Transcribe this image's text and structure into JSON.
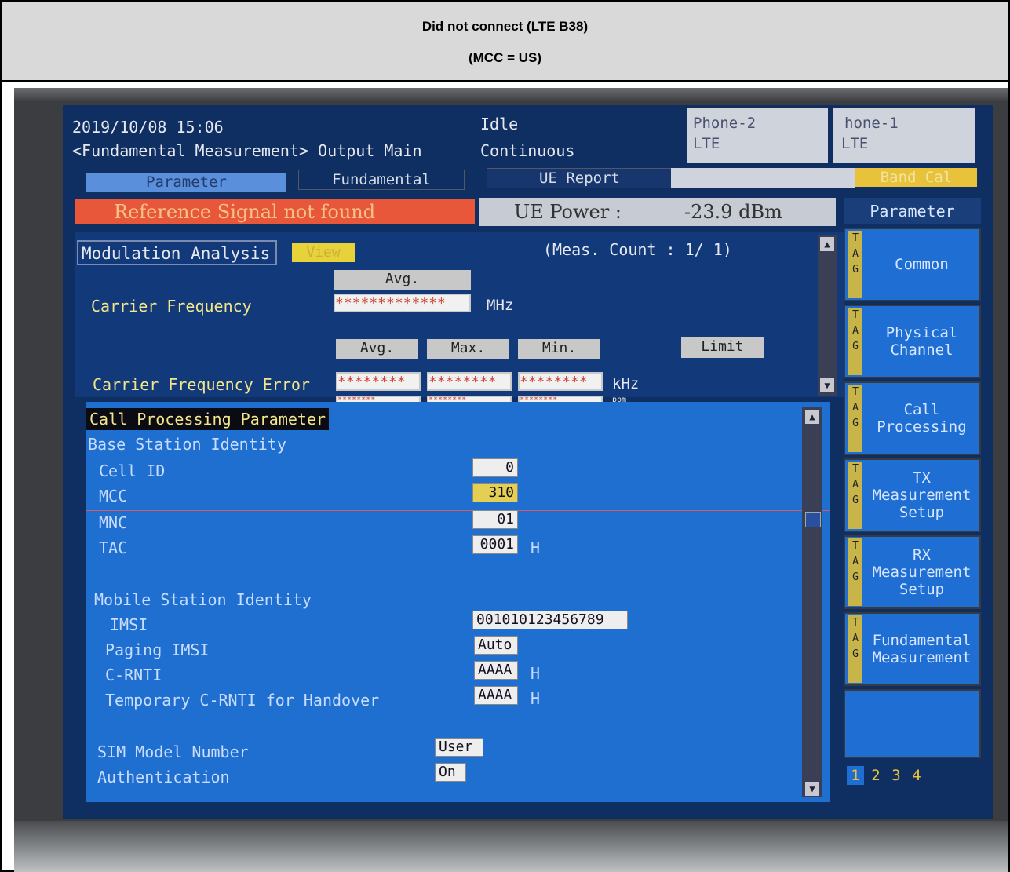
{
  "header": {
    "line1": "Did not connect (LTE B38)",
    "line2": "(MCC = US)"
  },
  "status": {
    "datetime": "2019/10/08 15:06",
    "screen_name": "<Fundamental Measurement> Output Main",
    "state_line1": "Idle",
    "state_line2": "Continuous",
    "phone2_name": "Phone-2",
    "phone2_tech": "LTE",
    "phone1_name": "hone-1",
    "phone1_tech": "LTE"
  },
  "tabs": {
    "parameter": "Parameter",
    "fundamental": "Fundamental",
    "ue_report": "UE Report",
    "band_cal": "Band Cal"
  },
  "alert": "Reference Signal not found",
  "ue_power": {
    "label": "UE Power :",
    "value": "-23.9 dBm"
  },
  "modulation": {
    "title": "Modulation Analysis",
    "view_button": "View",
    "meas_count": "(Meas. Count :      1/      1)",
    "avg_header": "Avg.",
    "carrier_freq_label": "Carrier Frequency",
    "carrier_freq_value": "*************",
    "carrier_freq_unit": "MHz",
    "err_avg": "Avg.",
    "err_max": "Max.",
    "err_min": "Min.",
    "limit_button": "Limit",
    "cfe_label": "Carrier Frequency Error",
    "cfe_avg": "********",
    "cfe_max": "********",
    "cfe_min": "********",
    "cfe_unit": "kHz",
    "cfe2_avg": "********",
    "cfe2_max": "********",
    "cfe2_min": "********",
    "cfe2_unit": "ppm"
  },
  "call_processing": {
    "title": "Call Processing Parameter",
    "bsi_title": "Base Station Identity",
    "cell_id_label": "Cell ID",
    "cell_id_value": "0",
    "mcc_label": "MCC",
    "mcc_value": "310",
    "mnc_label": "MNC",
    "mnc_value": "01",
    "tac_label": "TAC",
    "tac_value": "0001",
    "tac_unit": "H",
    "msi_title": "Mobile Station Identity",
    "imsi_label": "IMSI",
    "imsi_value": "001010123456789",
    "paging_imsi_label": "Paging IMSI",
    "paging_imsi_value": "Auto",
    "crnti_label": "C-RNTI",
    "crnti_value": "AAAA",
    "crnti_unit": "H",
    "tcrnti_label": "Temporary C-RNTI for Handover",
    "tcrnti_value": "AAAA",
    "tcrnti_unit": "H",
    "sim_label": "SIM Model Number",
    "sim_value": "User",
    "auth_label": "Authentication",
    "auth_value": "On"
  },
  "softkeys": {
    "title": "Parameter",
    "tag_letters": [
      "T",
      "A",
      "G"
    ],
    "k1": "Common",
    "k2": "Physical\nChannel",
    "k3": "Call\nProcessing",
    "k4": "TX\nMeasurement\nSetup",
    "k5": "RX\nMeasurement\nSetup",
    "k6": "Fundamental\nMeasurement",
    "pages": [
      "1",
      "2",
      "3",
      "4"
    ]
  },
  "colors": {
    "screen_bg": "#0f2f63",
    "panel_blue": "#1e6fd0",
    "alert_red": "#e8573a",
    "tag_yellow": "#c7b54a"
  }
}
